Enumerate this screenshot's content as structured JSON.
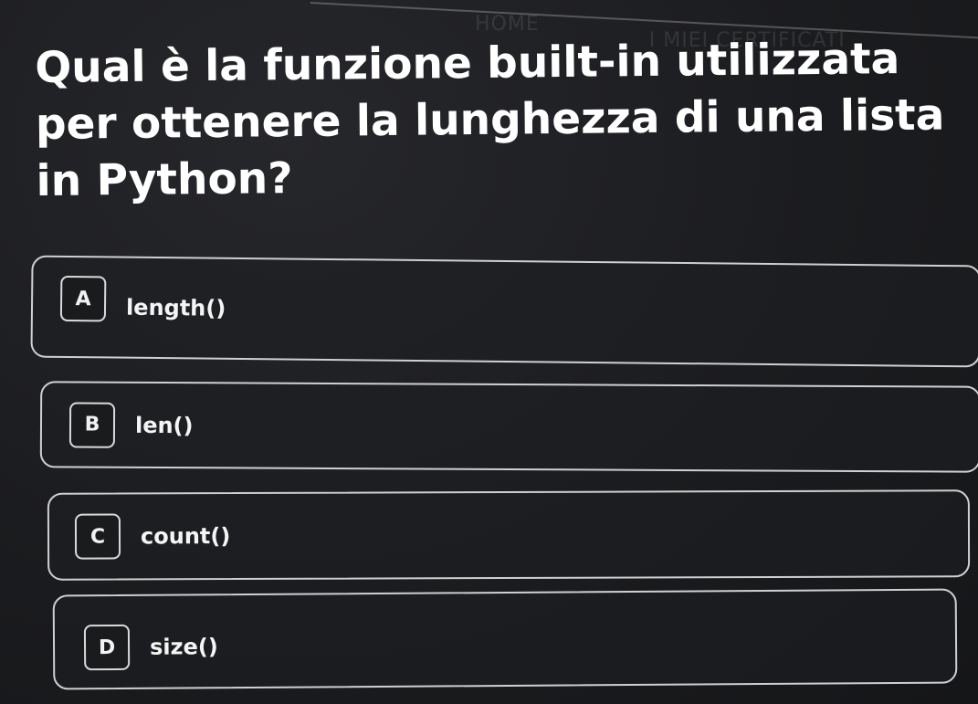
{
  "nav": {
    "home": "HOME",
    "certificates": "I MIEI CERTIFICATI"
  },
  "quiz": {
    "question": "Qual è la funzione built-in utilizzata per ottenere la lunghezza di una lista in Python?",
    "options": [
      {
        "letter": "A",
        "text": "length()"
      },
      {
        "letter": "B",
        "text": "len()"
      },
      {
        "letter": "C",
        "text": "count()"
      },
      {
        "letter": "D",
        "text": "size()"
      }
    ]
  },
  "colors": {
    "background": "#1c1d20",
    "border": "#cfd0d2",
    "text": "#ffffff"
  }
}
